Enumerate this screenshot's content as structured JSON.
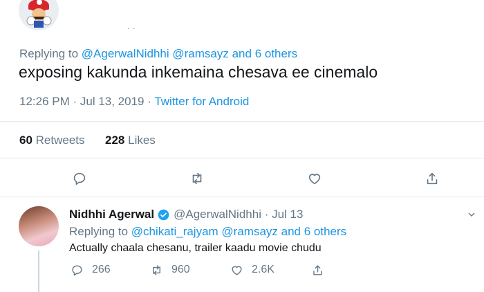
{
  "main_tweet": {
    "replying_prefix": "Replying to",
    "replying_to": "@AgerwalNidhhi @ramsayz and 6 others",
    "text": "exposing kakunda inkemaina chesava ee cinemalo",
    "time_date": "12:26 PM · Jul 13, 2019 · ",
    "source": "Twitter for Android",
    "retweets_count": "60",
    "retweets_label": "Retweets",
    "likes_count": "228",
    "likes_label": "Likes",
    "avatar_icon": "mario-avatar"
  },
  "reply_tweet": {
    "name": "Nidhhi Agerwal",
    "handle": "@AgerwalNidhhi · Jul 13",
    "replying_prefix": "Replying to",
    "replying_to": "@chikati_rajyam @ramsayz and 6 others",
    "text": "Actually chaala chesanu, trailer kaadu movie chudu",
    "reply_count": "266",
    "retweet_count": "960",
    "like_count": "2.6K"
  },
  "colors": {
    "link": "#1b95e0",
    "secondary_text": "#657786",
    "divider": "#e6ecf0"
  }
}
